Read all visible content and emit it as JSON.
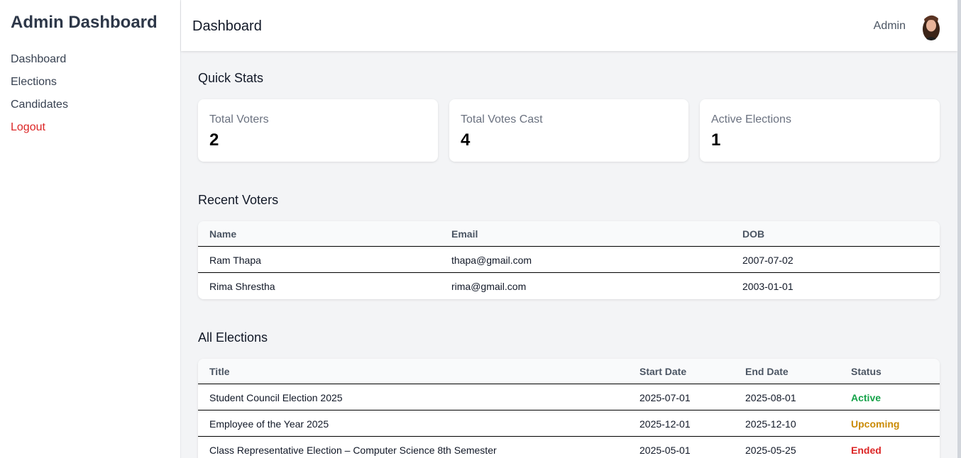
{
  "sidebar": {
    "brand": "Admin Dashboard",
    "items": [
      {
        "label": "Dashboard"
      },
      {
        "label": "Elections"
      },
      {
        "label": "Candidates"
      },
      {
        "label": "Logout"
      }
    ]
  },
  "header": {
    "title": "Dashboard",
    "user": "Admin"
  },
  "quick_stats": {
    "title": "Quick Stats",
    "cards": [
      {
        "label": "Total Voters",
        "value": "2"
      },
      {
        "label": "Total Votes Cast",
        "value": "4"
      },
      {
        "label": "Active Elections",
        "value": "1"
      }
    ]
  },
  "recent_voters": {
    "title": "Recent Voters",
    "columns": [
      "Name",
      "Email",
      "DOB"
    ],
    "rows": [
      {
        "name": "Ram Thapa",
        "email": "thapa@gmail.com",
        "dob": "2007-07-02"
      },
      {
        "name": "Rima Shrestha",
        "email": "rima@gmail.com",
        "dob": "2003-01-01"
      }
    ]
  },
  "elections": {
    "title": "All Elections",
    "columns": [
      "Title",
      "Start Date",
      "End Date",
      "Status"
    ],
    "rows": [
      {
        "title": "Student Council Election 2025",
        "start": "2025-07-01",
        "end": "2025-08-01",
        "status": "Active",
        "status_color": "#16a34a"
      },
      {
        "title": "Employee of the Year 2025",
        "start": "2025-12-01",
        "end": "2025-12-10",
        "status": "Upcoming",
        "status_color": "#ca8a04"
      },
      {
        "title": "Class Representative Election – Computer Science 8th Semester",
        "start": "2025-05-01",
        "end": "2025-05-25",
        "status": "Ended",
        "status_color": "#dc2626"
      }
    ]
  }
}
